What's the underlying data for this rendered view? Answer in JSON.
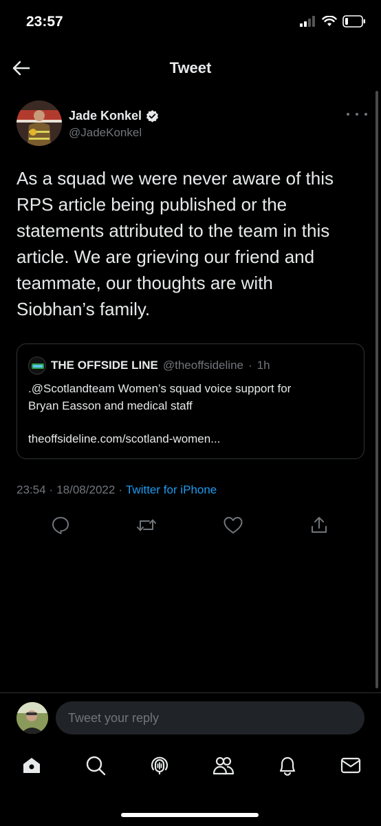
{
  "status_bar": {
    "time": "23:57"
  },
  "header": {
    "title": "Tweet"
  },
  "author": {
    "name": "Jade Konkel",
    "handle": "@JadeKonkel"
  },
  "tweet": {
    "lines": [
      "As a squad we were never aware of this",
      "RPS article being published or the",
      "statements attributed to the team in this",
      "article. We are grieving our friend and",
      "teammate, our thoughts are with",
      "Siobhan’s family."
    ],
    "time": "23:54",
    "date": "18/08/2022",
    "source": "Twitter for iPhone"
  },
  "quote": {
    "name": "THE OFFSIDE LINE",
    "handle": "@theoffsideline",
    "age": "1h",
    "text_line1": ".@Scotlandteam Women’s squad voice support for",
    "text_line2": "Bryan Easson and medical staff",
    "link": "theoffsideline.com/scotland-women..."
  },
  "reply": {
    "placeholder": "Tweet your reply"
  },
  "colors": {
    "accent": "#1d9bf0",
    "muted": "#71767b",
    "text": "#e7e9ea",
    "background": "#000000",
    "verified": "#e7e9ea"
  },
  "icons": {
    "back": "arrow-left-icon",
    "verified": "verified-badge-icon",
    "more": "more-horizontal-icon",
    "reply": "reply-icon",
    "retweet": "retweet-icon",
    "like": "heart-icon",
    "share": "share-icon",
    "home": "home-icon",
    "search": "search-icon",
    "spaces": "spaces-icon",
    "communities": "communities-icon",
    "notifications": "bell-icon",
    "messages": "mail-icon"
  }
}
